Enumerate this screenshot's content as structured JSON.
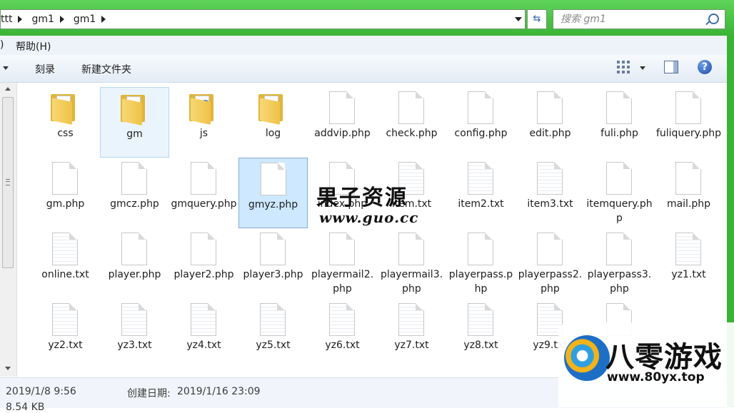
{
  "address": {
    "crumbs": [
      "ttt",
      "gm1",
      "gm1"
    ],
    "search_placeholder": "搜索 gm1"
  },
  "menu": {
    "partial": ")",
    "help": "帮助(H)"
  },
  "toolbar": {
    "burn": "刻录",
    "new_folder": "新建文件夹"
  },
  "files": [
    {
      "name": "css",
      "type": "folder"
    },
    {
      "name": "gm",
      "type": "folder"
    },
    {
      "name": "js",
      "type": "folder-qq"
    },
    {
      "name": "log",
      "type": "folder"
    },
    {
      "name": "addvip.php",
      "type": "file"
    },
    {
      "name": "check.php",
      "type": "file"
    },
    {
      "name": "config.php",
      "type": "file"
    },
    {
      "name": "edit.php",
      "type": "file"
    },
    {
      "name": "fuli.php",
      "type": "file"
    },
    {
      "name": "fuliquery.php",
      "type": "file"
    },
    {
      "name": "gm.php",
      "type": "file"
    },
    {
      "name": "gmcz.php",
      "type": "file"
    },
    {
      "name": "gmquery.php",
      "type": "file"
    },
    {
      "name": "gmyz.php",
      "type": "file"
    },
    {
      "name": "index.php",
      "type": "file"
    },
    {
      "name": "item.txt",
      "type": "txt"
    },
    {
      "name": "item2.txt",
      "type": "txt"
    },
    {
      "name": "item3.txt",
      "type": "txt"
    },
    {
      "name": "itemquery.php",
      "type": "file"
    },
    {
      "name": "mail.php",
      "type": "file"
    },
    {
      "name": "online.txt",
      "type": "txt"
    },
    {
      "name": "player.php",
      "type": "file"
    },
    {
      "name": "player2.php",
      "type": "file"
    },
    {
      "name": "player3.php",
      "type": "file"
    },
    {
      "name": "playermail2.php",
      "type": "file"
    },
    {
      "name": "playermail3.php",
      "type": "file"
    },
    {
      "name": "playerpass.php",
      "type": "file"
    },
    {
      "name": "playerpass2.php",
      "type": "file"
    },
    {
      "name": "playerpass3.php",
      "type": "file"
    },
    {
      "name": "yz1.txt",
      "type": "txt"
    },
    {
      "name": "yz2.txt",
      "type": "txt"
    },
    {
      "name": "yz3.txt",
      "type": "txt"
    },
    {
      "name": "yz4.txt",
      "type": "txt"
    },
    {
      "name": "yz5.txt",
      "type": "txt"
    },
    {
      "name": "yz6.txt",
      "type": "txt"
    },
    {
      "name": "yz7.txt",
      "type": "txt"
    },
    {
      "name": "yz8.txt",
      "type": "txt"
    },
    {
      "name": "yz9.txt",
      "type": "txt"
    },
    {
      "name": "",
      "type": "file"
    }
  ],
  "watermark": {
    "title": "果子资源",
    "url": "www.guo.cc"
  },
  "status": {
    "modified": "2019/1/8 9:56",
    "created_label": "创建日期:",
    "created_value": "2019/1/16 23:09",
    "size": "8.54 KB"
  },
  "logo": {
    "text": "八零游戏",
    "url": "www.80yx.top"
  },
  "colors": {
    "address_bar": "#3bb436",
    "selection": "#cde8ff"
  }
}
